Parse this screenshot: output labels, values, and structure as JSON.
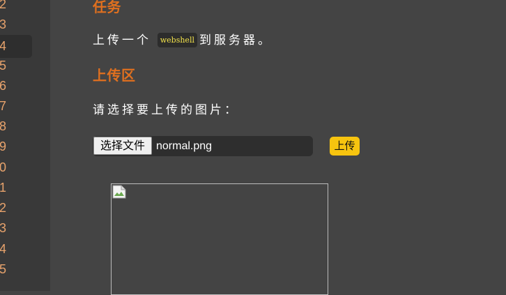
{
  "gutter": {
    "line_numbers": [
      "2",
      "3",
      "4",
      "5",
      "6",
      "7",
      "8",
      "9",
      "0",
      "1",
      "2",
      "3",
      "4",
      "5"
    ],
    "active_index": 2
  },
  "task": {
    "heading": "任务",
    "text_before": "上传一个",
    "code": "webshell",
    "text_after": "到服务器。"
  },
  "upload_area": {
    "heading": "上传区",
    "prompt": "请选择要上传的图片：",
    "choose_file_label": "选择文件",
    "file_name": "normal.png",
    "upload_label": "上传"
  },
  "preview": {
    "icon": "broken-image-icon"
  },
  "colors": {
    "background": "#444444",
    "gutter": "#393939",
    "line_number": "#e8a36c",
    "heading": "#e0701f",
    "code_text": "#f2e24b",
    "upload_button": "#f7c40f"
  }
}
